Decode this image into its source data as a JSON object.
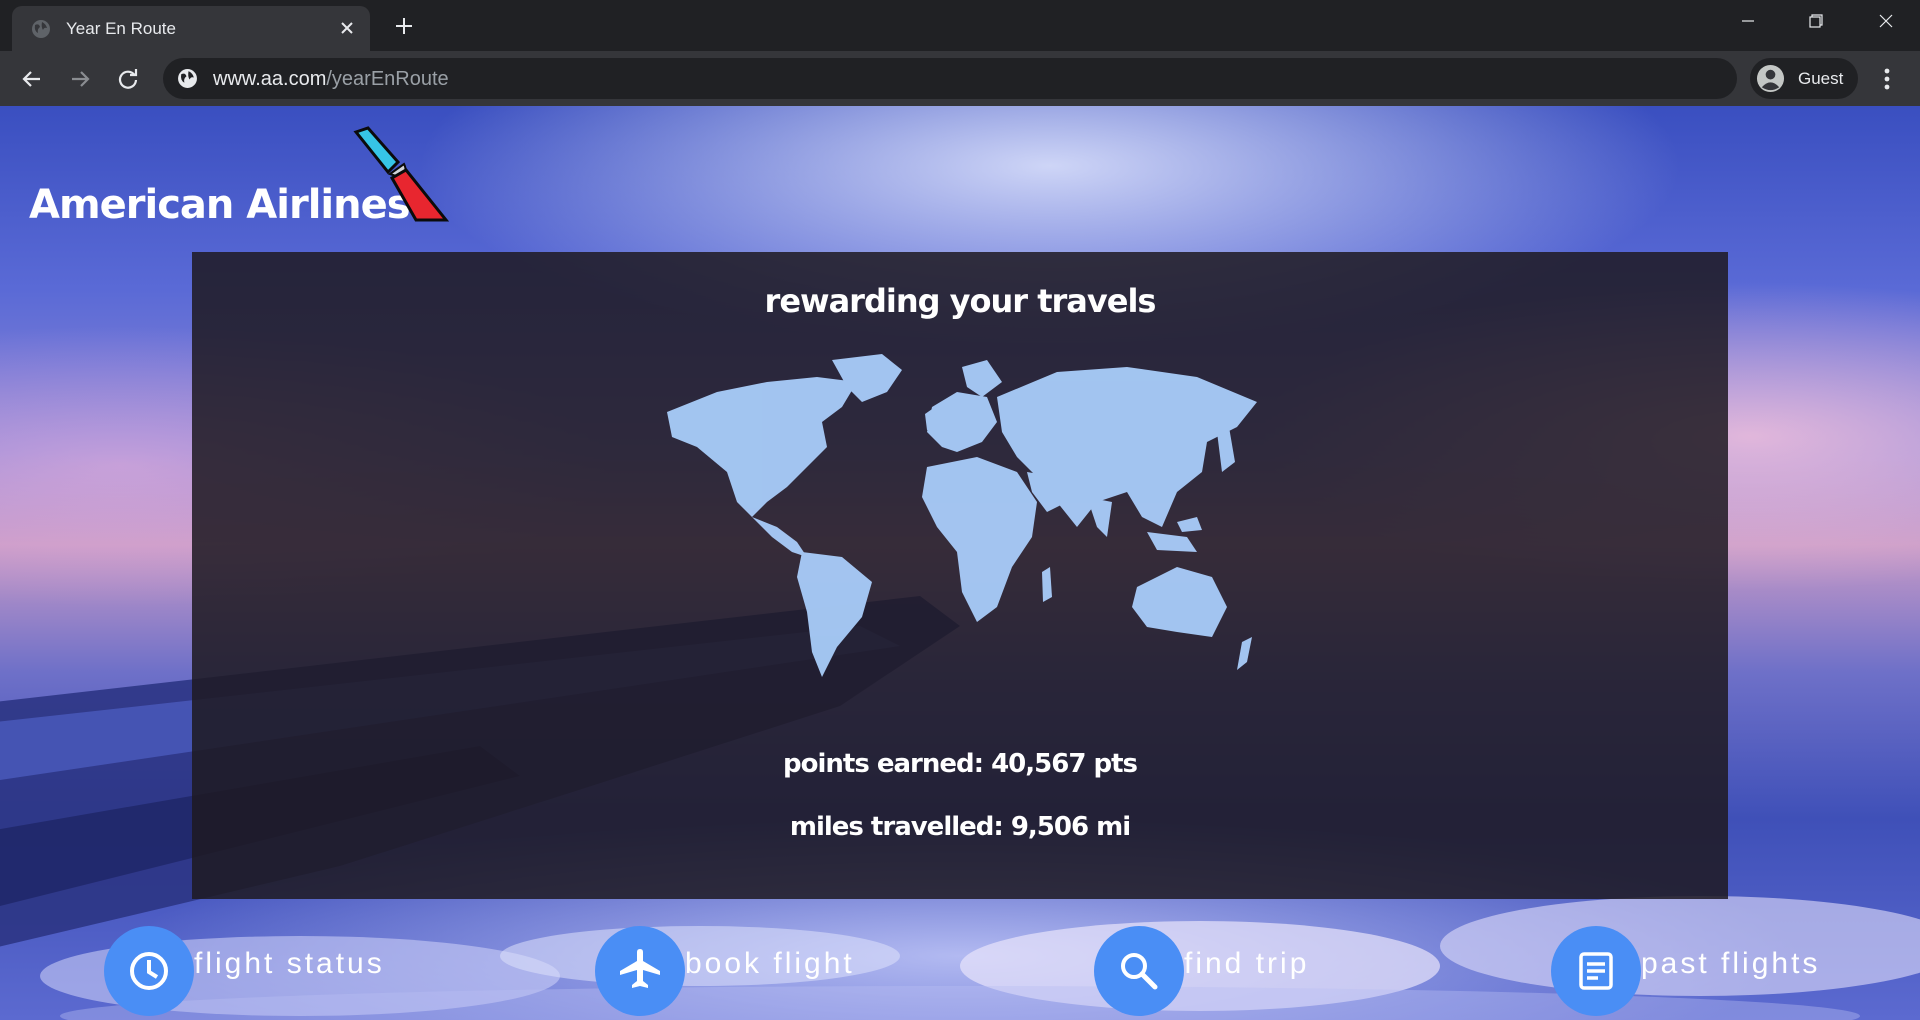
{
  "browser": {
    "tab_title": "Year En Route",
    "url_host": "www.aa.com",
    "url_path": "/yearEnRoute",
    "profile_label": "Guest"
  },
  "page": {
    "brand": "American Airlines",
    "panel_title": "rewarding your travels",
    "points_earned": "points earned: 40,567 pts",
    "miles_travelled": "miles travelled: 9,506 mi",
    "actions": [
      {
        "label": "flight status",
        "icon": "clock-icon"
      },
      {
        "label": "book flight",
        "icon": "airplane-icon"
      },
      {
        "label": "find trip",
        "icon": "search-icon"
      },
      {
        "label": "past flights",
        "icon": "document-icon"
      }
    ]
  },
  "colors": {
    "action_circle": "#4a8ef5",
    "map_fill": "#a9cdfa",
    "logo_blue": "#36c5e6",
    "logo_red": "#e8262f",
    "panel": "#1e1a22"
  }
}
